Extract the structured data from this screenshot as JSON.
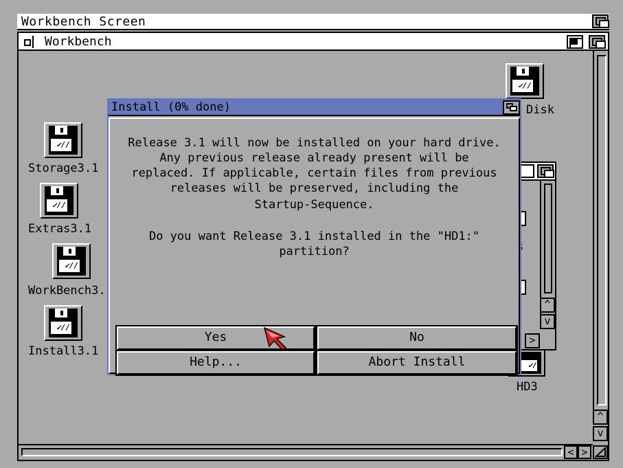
{
  "screen": {
    "title": "Workbench Screen"
  },
  "window": {
    "title": "Workbench"
  },
  "icons": [
    {
      "label": "Storage3.1",
      "icon": "floppy-disk-icon"
    },
    {
      "label": "Extras3.1",
      "icon": "floppy-disk-icon"
    },
    {
      "label": "WorkBench3.",
      "icon": "floppy-disk-icon"
    },
    {
      "label": "Install3.1",
      "icon": "floppy-disk-icon"
    },
    {
      "label": "Disk",
      "icon": "floppy-disk-icon"
    },
    {
      "label": "HD3",
      "icon": "hard-disk-icon"
    }
  ],
  "partial_window": {
    "text_s": "s"
  },
  "dialog": {
    "title": "Install (0% done)",
    "message_lines": [
      "Release 3.1 will now be installed on your hard drive.",
      "Any previous release already present will be",
      "replaced. If applicable, certain files from previous",
      "releases will be preserved, including the",
      "Startup-Sequence.",
      "Do you want Release 3.1 installed in the \"HD1:\"",
      "partition?"
    ],
    "buttons": {
      "yes": "Yes",
      "no": "No",
      "help": "Help...",
      "abort": "Abort Install"
    }
  },
  "arrows": {
    "up": "^",
    "down": "v",
    "left": "<",
    "right": ">"
  },
  "colors": {
    "background": "#aaaaaa",
    "dialog_title": "#6677bb",
    "pointer": "#dd2222"
  }
}
